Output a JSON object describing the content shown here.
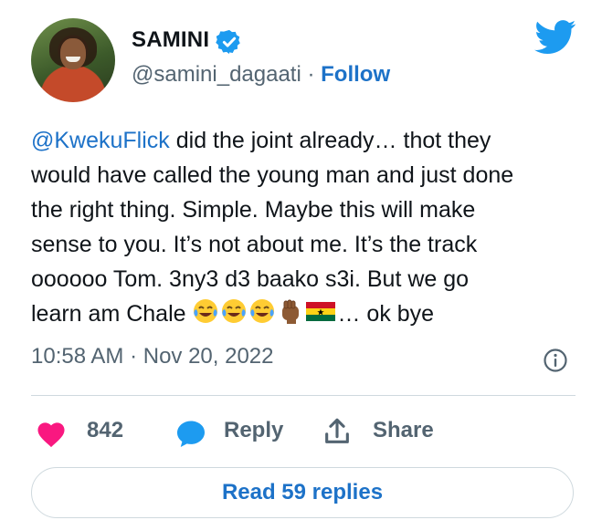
{
  "author": {
    "display_name": "SAMINI",
    "handle": "@samini_dagaati",
    "separator": " · ",
    "follow_label": "Follow",
    "verified": true
  },
  "tweet": {
    "mention": "@KwekuFlick",
    "text_line1_rest": " did the joint already… thot they",
    "text_rest": "would have called the young man and just done\nthe right thing. Simple. Maybe this will make\nsense to you. It’s not about me. It’s the track\noooooo Tom. 3ny3 d3 baako s3i. But we go\nlearn am Chale ",
    "emojis": [
      "face-with-tears-of-joy",
      "face-with-tears-of-joy",
      "face-with-tears-of-joy",
      "raised-fist-medium-dark",
      "flag-ghana"
    ],
    "text_tail": "… ok bye"
  },
  "timestamp": "10:58 AM · Nov 20, 2022",
  "actions": {
    "likes": "842",
    "reply_label": "Reply",
    "share_label": "Share"
  },
  "read_replies_label": "Read 59 replies",
  "colors": {
    "link": "#1d72c8",
    "like": "#f91880",
    "secondary_text": "#536471",
    "brand": "#1d9bf0"
  }
}
